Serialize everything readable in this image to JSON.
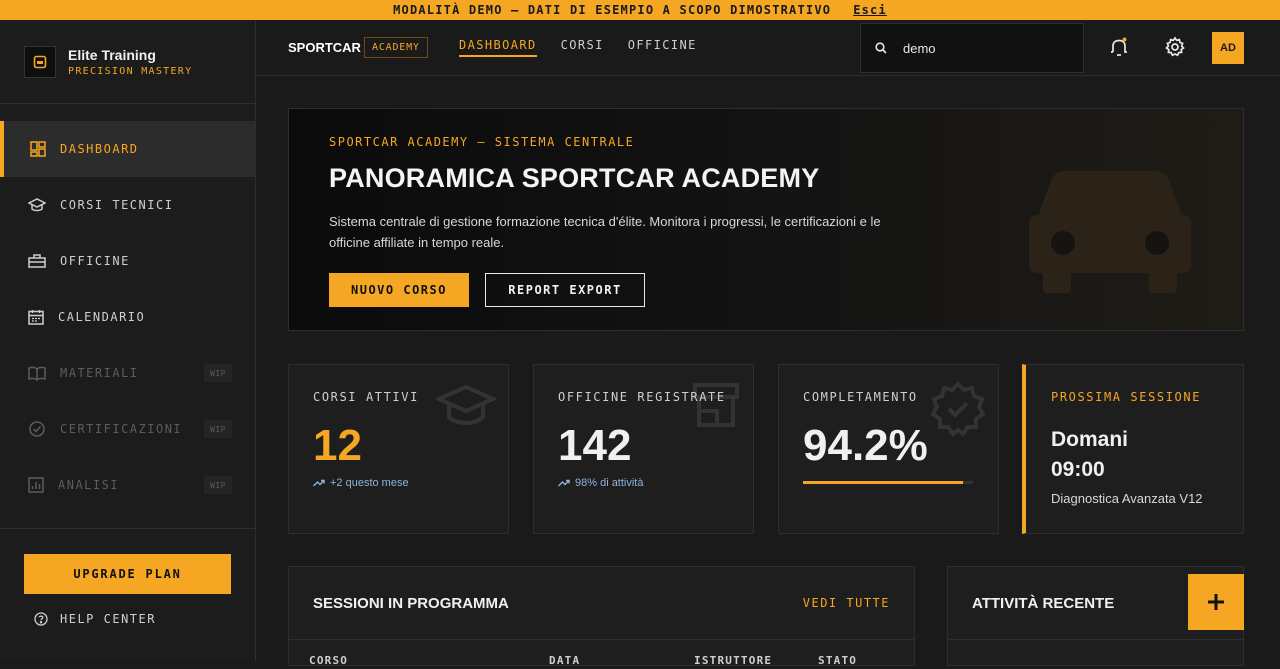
{
  "banner": {
    "text": "MODALITÀ DEMO — DATI DI ESEMPIO A SCOPO DIMOSTRATIVO",
    "exit_label": "Esci"
  },
  "sidebar": {
    "brand_title": "Elite Training",
    "brand_subtitle": "PRECISION MASTERY",
    "items": [
      {
        "label": "DASHBOARD",
        "icon": "dashboard-icon",
        "active": true
      },
      {
        "label": "CORSI TECNICI",
        "icon": "graduation-cap-icon"
      },
      {
        "label": "OFFICINE",
        "icon": "toolbox-icon"
      },
      {
        "label": "CALENDARIO",
        "icon": "calendar-icon"
      },
      {
        "label": "MATERIALI",
        "icon": "book-icon",
        "badge": "WIP",
        "disabled": true
      },
      {
        "label": "CERTIFICAZIONI",
        "icon": "verified-badge-icon",
        "badge": "WIP",
        "disabled": true
      },
      {
        "label": "ANALISI",
        "icon": "analytics-icon",
        "badge": "WIP",
        "disabled": true
      }
    ],
    "upgrade_label": "UPGRADE PLAN",
    "help_label": "HELP CENTER"
  },
  "topbar": {
    "brand": "SPORTCAR",
    "badge": "ACADEMY",
    "nav": [
      "DASHBOARD",
      "CORSI",
      "OFFICINE"
    ],
    "search_value": "demo",
    "avatar_initials": "AD"
  },
  "hero": {
    "eyebrow": "SPORTCAR ACADEMY — SISTEMA CENTRALE",
    "title": "PANORAMICA SPORTCAR ACADEMY",
    "description": "Sistema centrale di gestione formazione tecnica d'élite. Monitora i progressi, le certificazioni e le officine affiliate in tempo reale.",
    "primary_button": "NUOVO CORSO",
    "secondary_button": "REPORT EXPORT"
  },
  "stats": [
    {
      "label": "CORSI ATTIVI",
      "value": "12",
      "trend": "+2 questo mese",
      "icon": "graduation-cap-icon"
    },
    {
      "label": "OFFICINE REGISTRATE",
      "value": "142",
      "trend": "98% di attività",
      "icon": "storefront-icon"
    },
    {
      "label": "COMPLETAMENTO",
      "value": "94.2%",
      "progress": 0.942,
      "icon": "verified-badge-icon"
    }
  ],
  "next_session": {
    "label": "PROSSIMA SESSIONE",
    "day": "Domani",
    "time": "09:00",
    "course": "Diagnostica Avanzata V12"
  },
  "sessions": {
    "title": "SESSIONI IN PROGRAMMA",
    "link": "VEDI TUTTE",
    "columns": [
      "CORSO",
      "DATA",
      "ISTRUTTORE",
      "STATO"
    ]
  },
  "activity": {
    "title": "ATTIVITÀ RECENTE"
  },
  "colors": {
    "accent": "#f5a623",
    "background": "#1a1a1a",
    "card": "#1e1e1e",
    "trend": "#8fb4d8"
  }
}
